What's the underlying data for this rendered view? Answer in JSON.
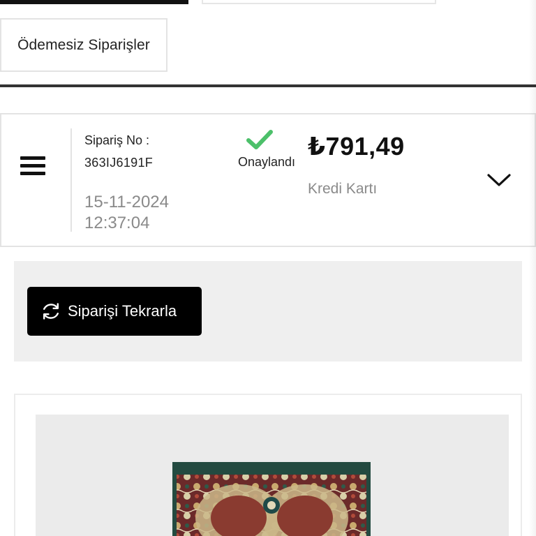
{
  "filters": {
    "unpaid_orders_label": "Ödemesiz Siparişler"
  },
  "order": {
    "order_no_label": "Sipariş No :",
    "order_no": "363IJ6191F",
    "date": "15-11-2024",
    "time": "12:37:04",
    "status": "Onaylandı",
    "status_color": "#4cc06a",
    "price": "₺791,49",
    "payment_method": "Kredi Kartı"
  },
  "actions": {
    "reorder_label": "Siparişi Tekrarla",
    "reorder_icon": "refresh-icon"
  },
  "icons": {
    "menu": "hamburger-menu-icon",
    "status": "check-icon",
    "expand": "chevron-down-icon"
  },
  "colors": {
    "primary_button_bg": "#000000",
    "muted_text": "#8a8a8a",
    "panel_bg": "#efefef"
  }
}
